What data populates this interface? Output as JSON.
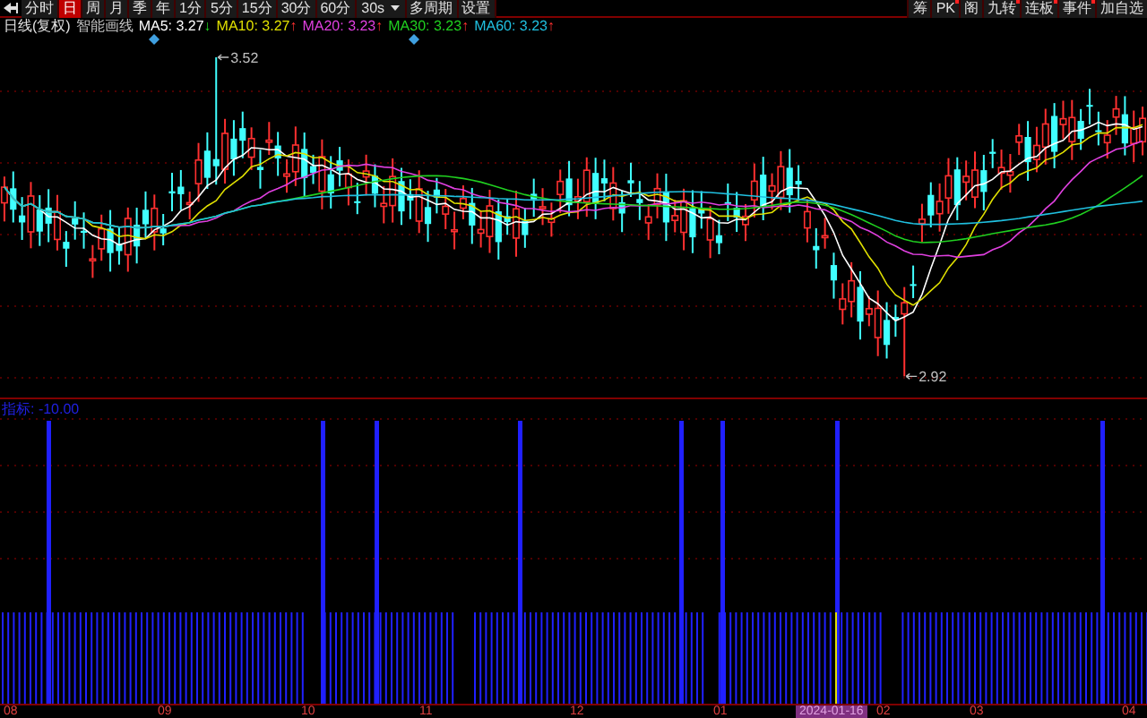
{
  "toolbar": {
    "periods": [
      {
        "label": "分时",
        "selected": false
      },
      {
        "label": "日",
        "selected": true
      },
      {
        "label": "周",
        "selected": false
      },
      {
        "label": "月",
        "selected": false
      },
      {
        "label": "季",
        "selected": false
      },
      {
        "label": "年",
        "selected": false
      },
      {
        "label": "1分",
        "selected": false
      },
      {
        "label": "5分",
        "selected": false
      },
      {
        "label": "15分",
        "selected": false
      },
      {
        "label": "30分",
        "selected": false
      },
      {
        "label": "60分",
        "selected": false
      }
    ],
    "interval": "30s",
    "buttons": [
      "多周期",
      "设置"
    ],
    "right_buttons": [
      {
        "label": "筹",
        "badge": false
      },
      {
        "label": "PK",
        "badge": true
      },
      {
        "label": "阁",
        "badge": false
      },
      {
        "label": "九转",
        "badge": true
      },
      {
        "label": "连板",
        "badge": true
      },
      {
        "label": "事件",
        "badge": true
      },
      {
        "label": "加自选",
        "badge": false
      }
    ]
  },
  "legend": {
    "title": "日线(复权)",
    "subtitle": "智能画线",
    "items": [
      {
        "label": "MA5: 3.27",
        "arrow": "↓",
        "color": "#ffffff"
      },
      {
        "label": "MA10: 3.27",
        "arrow": "↑",
        "color": "#e0e000"
      },
      {
        "label": "MA20: 3.23",
        "arrow": "↑",
        "color": "#e040e0"
      },
      {
        "label": "MA30: 3.23",
        "arrow": "↑",
        "color": "#20d020"
      },
      {
        "label": "MA60: 3.23",
        "arrow": "↑",
        "color": "#20c0e0"
      }
    ]
  },
  "price_marks": {
    "high": "3.52",
    "low": "2.92"
  },
  "indicator": {
    "label": "指标: -10.00"
  },
  "x_axis": [
    {
      "label": "08",
      "selected": false
    },
    {
      "label": "09",
      "selected": false
    },
    {
      "label": "10",
      "selected": false
    },
    {
      "label": "11",
      "selected": false
    },
    {
      "label": "12",
      "selected": false
    },
    {
      "label": "01",
      "selected": false
    },
    {
      "label": "2024-01-16",
      "selected": true
    },
    {
      "label": "02",
      "selected": false
    },
    {
      "label": "03",
      "selected": false
    },
    {
      "label": "04",
      "selected": false
    }
  ]
}
